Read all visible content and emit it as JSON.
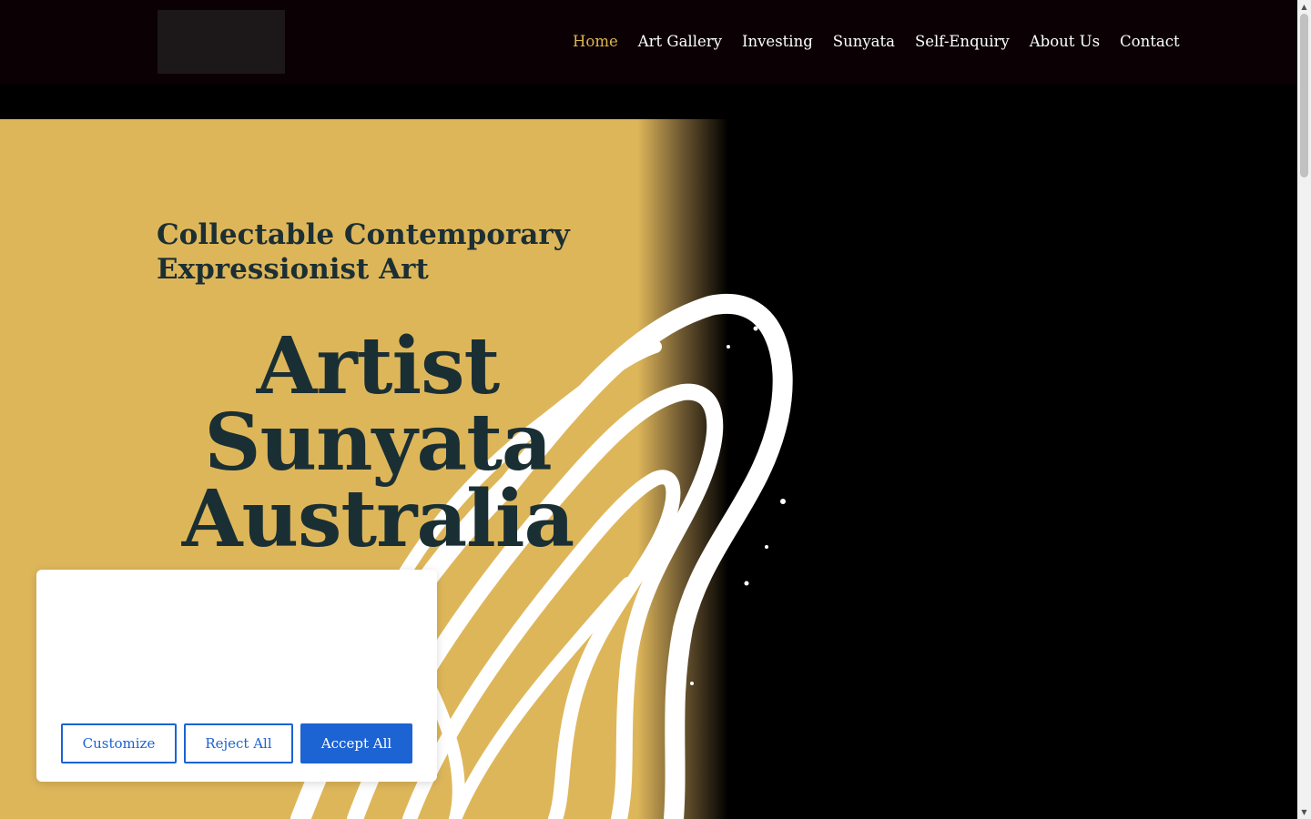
{
  "header": {
    "logo_alt": "",
    "nav": [
      {
        "label": "Home",
        "active": true
      },
      {
        "label": "Art Gallery",
        "active": false
      },
      {
        "label": "Investing",
        "active": false
      },
      {
        "label": "Sunyata",
        "active": false
      },
      {
        "label": "Self-Enquiry",
        "active": false
      },
      {
        "label": "About Us",
        "active": false
      },
      {
        "label": "Contact",
        "active": false
      }
    ]
  },
  "hero": {
    "subtitle": "Collectable Contemporary Expressionist Art",
    "title_lines": [
      "Artist",
      "Sunyata",
      "Australia"
    ]
  },
  "cookie_banner": {
    "customize_label": "Customize",
    "reject_label": "Reject All",
    "accept_label": "Accept All"
  },
  "colors": {
    "header_bg": "#0b0104",
    "nav_active": "#e0b64f",
    "hero_gold": "#deb65a",
    "hero_text": "#1a2f34",
    "cookie_button": "#1c63d3"
  },
  "icons": {
    "scroll_up": "scroll-up-arrow-icon",
    "scroll_down": "scroll-down-arrow-icon"
  }
}
